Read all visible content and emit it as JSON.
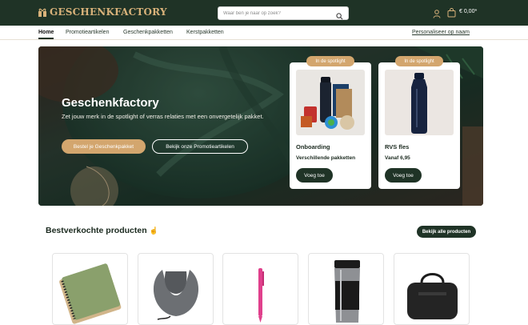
{
  "header": {
    "logo_text": "GESCHENKFACTORY",
    "search_placeholder": "Waar ben je naar op zoek?",
    "cart_total": "€ 0,00*",
    "colors": {
      "bar": "#1f3326",
      "gold": "#d3a66e"
    }
  },
  "nav": {
    "items": [
      {
        "label": "Home",
        "active": true
      },
      {
        "label": "Promotieartikelen"
      },
      {
        "label": "Geschenkpakketten"
      },
      {
        "label": "Kerstpakketten"
      }
    ],
    "right_link": "Personaliseer op naam"
  },
  "hero": {
    "title": "Geschenkfactory",
    "subtitle": "Zet jouw merk in de spotlight of verras relaties met een onvergetelijk pakket.",
    "primary_button": "Bestel je Geschenkpakket",
    "secondary_button": "Bekijk onze Promotieartikelen",
    "cards": [
      {
        "badge": "In de spotlight",
        "name": "Onboarding",
        "price": "Verschillende pakketten",
        "button": "Voeg toe"
      },
      {
        "badge": "In de spotlight",
        "name": "RVS fles",
        "price": "Vanaf 6,95",
        "button": "Voeg toe"
      }
    ]
  },
  "bestsellers": {
    "title": "Bestverkochte producten",
    "view_all": "Bekijk alle producten",
    "products": [
      "notebook",
      "neck-pillow",
      "pen",
      "travel-mug",
      "duffel-bag"
    ]
  }
}
